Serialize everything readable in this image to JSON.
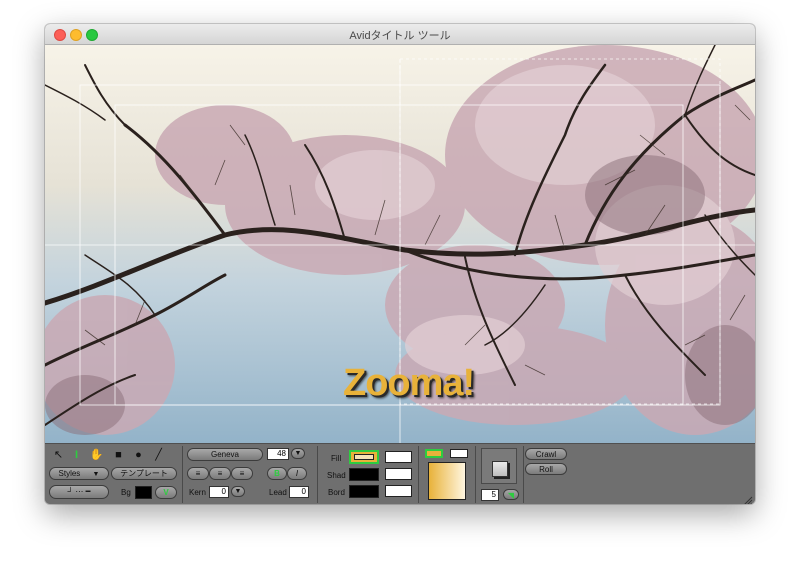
{
  "window": {
    "title": "Avidタイトル ツール"
  },
  "canvas": {
    "title_text": "Zooma!",
    "title_color": "#e8b23a"
  },
  "tools": {
    "arrow_icon": "arrow-pointer-icon",
    "text_icon": "text-cursor-icon",
    "hand_icon": "hand-icon",
    "rect_icon": "rectangle-icon",
    "oval_icon": "oval-icon",
    "line_icon": "line-icon"
  },
  "toolbar": {
    "styles_label": "Styles",
    "template_label": "テンプレート",
    "bg_label": "Bg",
    "font_name": "Geneva",
    "font_size": "48",
    "bold_label": "B",
    "italic_label": "I",
    "kern_label": "Kern",
    "kern_value": "0",
    "lead_label": "Lead",
    "lead_value": "0",
    "fill_label": "Fill",
    "shad_label": "Shad",
    "bord_label": "Bord",
    "depth_value": "5",
    "crawl_label": "Crawl",
    "roll_label": "Roll"
  },
  "colors": {
    "fill_gold": "#e8b23a",
    "active_green": "#2ecc40",
    "bg_black": "#000000"
  }
}
